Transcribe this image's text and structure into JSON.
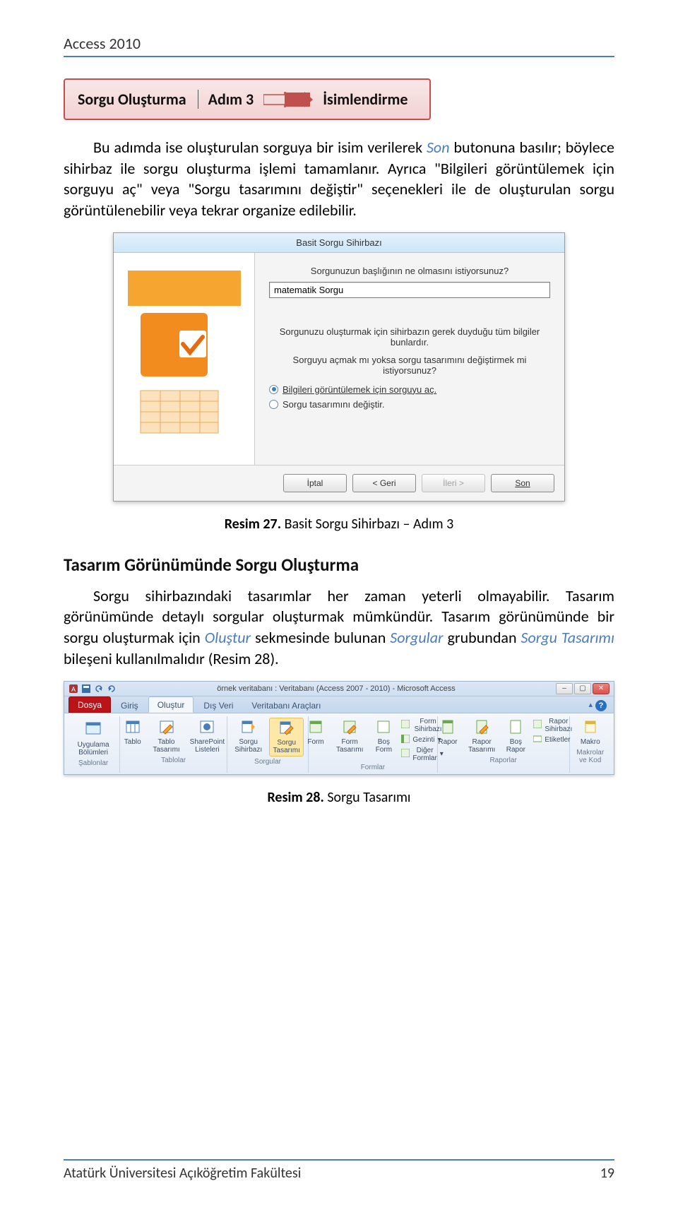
{
  "doc": {
    "header": "Access 2010",
    "footer_left": "Atatürk Üniversitesi Açıköğretim Fakültesi",
    "footer_page": "19"
  },
  "callout": {
    "title": "Sorgu Oluşturma",
    "step": "Adım 3",
    "target": "İsimlendirme"
  },
  "para1": {
    "a": "Bu adımda ise oluşturulan sorguya bir isim verilerek ",
    "son": "Son",
    "b": " butonuna basılır; böylece sihirbaz ile sorgu oluşturma işlemi tamamlanır. Ayrıca \"Bilgileri görüntülemek için sorguyu aç\" veya \"Sorgu tasarımını değiştir\" seçenekleri ile de oluşturulan sorgu görüntülenebilir veya tekrar organize edilebilir."
  },
  "wizard": {
    "title": "Basit Sorgu Sihirbazı",
    "q1": "Sorgunuzun başlığının ne olmasını istiyorsunuz?",
    "input_value": "matematik Sorgu",
    "desc1": "Sorgunuzu oluşturmak için sihirbazın gerek duyduğu tüm bilgiler bunlardır.",
    "desc2": "Sorguyu açmak mı yoksa sorgu tasarımını değiştirmek mi istiyorsunuz?",
    "radio1": "Bilgileri görüntülemek için sorguyu aç.",
    "radio2": "Sorgu tasarımını değiştir.",
    "btn_cancel": "İptal",
    "btn_back": "< Geri",
    "btn_next": "İleri >",
    "btn_finish": "Son"
  },
  "caption1": {
    "bold": "Resim 27.",
    "text": " Basit Sorgu Sihirbazı – Adım 3"
  },
  "h2": "Tasarım Görünümünde Sorgu Oluşturma",
  "para2": {
    "a": "Sorgu sihirbazındaki tasarımlar her zaman yeterli olmayabilir. Tasarım görünümünde detaylı sorgular oluşturmak mümkündür. Tasarım görünümünde bir sorgu oluşturmak için ",
    "olustur": "Oluştur",
    "b": " sekmesinde bulunan ",
    "sorgular": "Sorgular",
    "c": " grubundan ",
    "sorgu_tasarimi": "Sorgu Tasarımı",
    "d": " bileşeni kullanılmalıdır (Resim 28)."
  },
  "ribbon": {
    "title": "örnek veritabanı : Veritabanı (Access 2007 - 2010) - Microsoft Access",
    "tabs": {
      "file": "Dosya",
      "t1": "Giriş",
      "t2": "Oluştur",
      "t3": "Dış Veri",
      "t4": "Veritabanı Araçları"
    },
    "groups": {
      "sablonlar": "Şablonlar",
      "tablolar": "Tablolar",
      "sorgular": "Sorgular",
      "formlar": "Formlar",
      "raporlar": "Raporlar",
      "makrolar": "Makrolar ve Kod"
    },
    "items": {
      "uygulama_bolumleri": "Uygulama Bölümleri",
      "tablo": "Tablo",
      "tablo_tasarimi": "Tablo Tasarımı",
      "sharepoint_listeleri": "SharePoint Listeleri",
      "sorgu_sihirbazi": "Sorgu Sihirbazı",
      "sorgu_tasarimi": "Sorgu Tasarımı",
      "form": "Form",
      "form_tasarimi": "Form Tasarımı",
      "bos_form": "Boş Form",
      "form_sihirbazi": "Form Sihirbazı",
      "gezinti": "Gezinti",
      "diger_formlar": "Diğer Formlar",
      "rapor": "Rapor",
      "rapor_tasarimi": "Rapor Tasarımı",
      "bos_rapor": "Boş Rapor",
      "rapor_sihirbazi": "Rapor Sihirbazı",
      "etiketler": "Etiketler",
      "makro": "Makro"
    }
  },
  "caption2": {
    "bold": "Resim 28.",
    "text": " Sorgu Tasarımı"
  }
}
